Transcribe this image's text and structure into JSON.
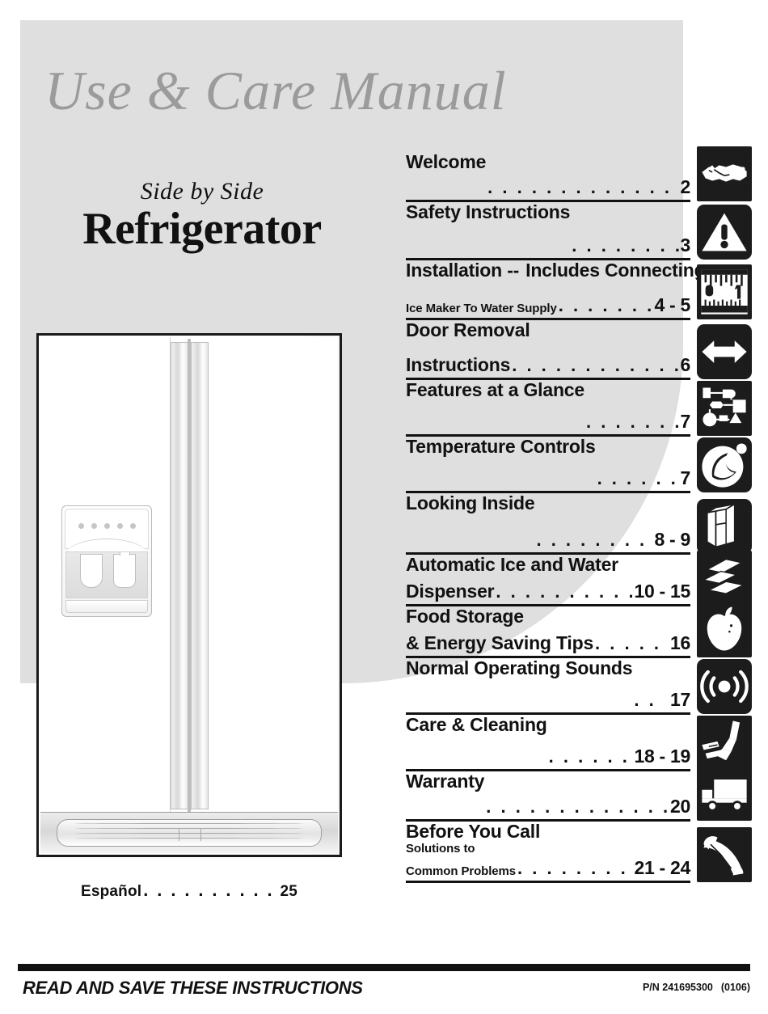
{
  "cover": {
    "main_title": "Use & Care Manual",
    "sub_title": "Side by Side",
    "product_title": "Refrigerator",
    "espanol_label": "Español",
    "espanol_leader": ". . . . . . . . . .",
    "espanol_page": "25"
  },
  "colors": {
    "gray_background": "#dfdfdf",
    "title_gray": "#9b9b9b",
    "ink": "#111111",
    "icon_background": "#1c1c1c",
    "page_white": "#ffffff"
  },
  "toc": {
    "entries": [
      {
        "title": "Welcome",
        "title_small": "",
        "subtitle": "",
        "leader": ". . . . . . . . . . . . . . . . . . . . .",
        "page": "2",
        "icon": "handshake-icon"
      },
      {
        "title": "Safety Instructions",
        "title_small": "",
        "subtitle": "",
        "leader": ". . . . . . . . . . .",
        "page": "3",
        "icon": "warning-triangle-icon"
      },
      {
        "title": "Installation --",
        "title_small": "Includes Connecting",
        "subtitle": "Ice Maker To Water Supply",
        "leader": ". . . . . . . . . . .",
        "page": "4 - 5",
        "icon": "tape-measure-icon"
      },
      {
        "title": "Door Removal",
        "title_small": "",
        "subtitle": "Instructions",
        "leader": ". . . . . . . . . . . . . . . . . .",
        "page": "6",
        "icon": "double-arrow-icon"
      },
      {
        "title": "Features at a Glance",
        "title_small": "",
        "subtitle": "",
        "leader": ". . . . . . . . .",
        "page": "7",
        "icon": "features-diagram-icon"
      },
      {
        "title": "Temperature Controls",
        "title_small": "",
        "subtitle": "",
        "leader": ". . . . . . .",
        "page": "7",
        "icon": "thermometer-dial-icon"
      },
      {
        "title": "Looking Inside",
        "title_small": "",
        "subtitle": "",
        "leader": ". . . . . . . . . .",
        "page": "8 - 9",
        "icon": "open-refrigerator-icon"
      },
      {
        "title": "Automatic Ice and Water",
        "title_small": "",
        "subtitle": "Dispenser",
        "leader": ". . . . . . . . . . . . . . . .",
        "page": "10 - 15",
        "icon": "ice-cubes-icon"
      },
      {
        "title": "Food Storage",
        "title_small": "",
        "subtitle": "& Energy Saving Tips",
        "leader": ". . . . . . .",
        "page": "16",
        "icon": "apple-icon"
      },
      {
        "title": "Normal Operating Sounds",
        "title_small": "",
        "subtitle": "",
        "leader": ". .",
        "page": "17",
        "icon": "sound-waves-icon"
      },
      {
        "title": "Care & Cleaning",
        "title_small": "",
        "subtitle": "",
        "leader": ". . . . . . . .",
        "page": "18 - 19",
        "icon": "cleaning-spray-icon"
      },
      {
        "title": "Warranty",
        "title_small": "",
        "subtitle": "",
        "leader": ". . . . . . . . . . . . . . . . . . . . .",
        "page": "20",
        "icon": "delivery-truck-icon"
      },
      {
        "title": "Before You Call",
        "title_small": "",
        "subtitle": "Solutions to\nCommon Problems",
        "leader": ". . . . . . . . . . . . .",
        "page": "21 - 24",
        "icon": "telephone-handset-icon"
      }
    ]
  },
  "illustration": {
    "name": "side-by-side-refrigerator",
    "dispenser_control_dots": 5
  },
  "footer": {
    "instruction": "READ AND SAVE THESE INSTRUCTIONS",
    "part_number_label": "P/N 241695300",
    "revision": "(0106)"
  }
}
